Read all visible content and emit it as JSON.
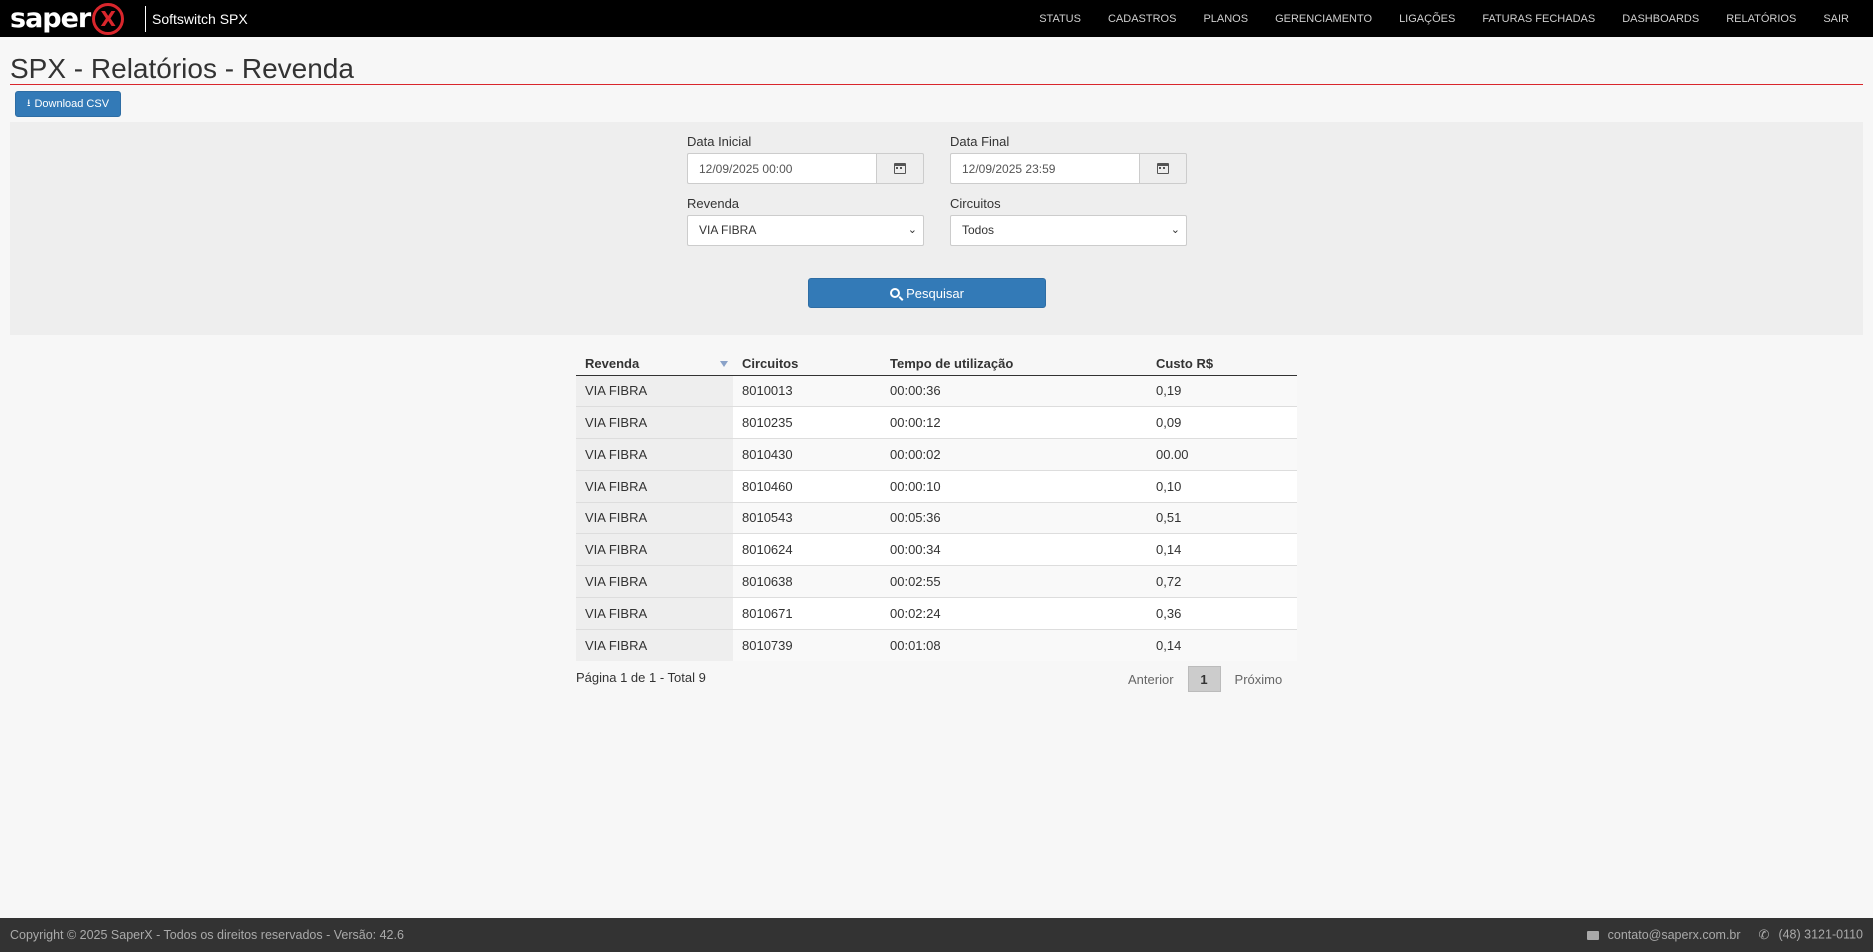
{
  "brand": {
    "logo_text": "saper",
    "logo_mark": "X",
    "product": "Softswitch SPX"
  },
  "nav": [
    "STATUS",
    "CADASTROS",
    "PLANOS",
    "GERENCIAMENTO",
    "LIGAÇÕES",
    "FATURAS FECHADAS",
    "DASHBOARDS",
    "RELATÓRIOS",
    "SAIR"
  ],
  "page": {
    "title": "SPX - Relatórios - Revenda",
    "download_label": "Download CSV"
  },
  "filters": {
    "data_inicial_label": "Data Inicial",
    "data_inicial_value": "12/09/2025 00:00",
    "data_final_label": "Data Final",
    "data_final_value": "12/09/2025 23:59",
    "revenda_label": "Revenda",
    "revenda_value": "VIA FIBRA",
    "circuitos_label": "Circuitos",
    "circuitos_value": "Todos",
    "search_label": "Pesquisar"
  },
  "table": {
    "headers": [
      "Revenda",
      "Circuitos",
      "Tempo de utilização",
      "Custo R$"
    ],
    "rows": [
      [
        "VIA FIBRA",
        "8010013",
        "00:00:36",
        "0,19"
      ],
      [
        "VIA FIBRA",
        "8010235",
        "00:00:12",
        "0,09"
      ],
      [
        "VIA FIBRA",
        "8010430",
        "00:00:02",
        "00.00"
      ],
      [
        "VIA FIBRA",
        "8010460",
        "00:00:10",
        "0,10"
      ],
      [
        "VIA FIBRA",
        "8010543",
        "00:05:36",
        "0,51"
      ],
      [
        "VIA FIBRA",
        "8010624",
        "00:00:34",
        "0,14"
      ],
      [
        "VIA FIBRA",
        "8010638",
        "00:02:55",
        "0,72"
      ],
      [
        "VIA FIBRA",
        "8010671",
        "00:02:24",
        "0,36"
      ],
      [
        "VIA FIBRA",
        "8010739",
        "00:01:08",
        "0,14"
      ]
    ]
  },
  "pagination": {
    "info": "Página 1 de 1 - Total 9",
    "prev": "Anterior",
    "current": "1",
    "next": "Próximo"
  },
  "footer": {
    "copyright": "Copyright © 2025 SaperX - Todos os direitos reservados - Versão: 42.6",
    "email": "contato@saperx.com.br",
    "phone": "(48) 3121-0110"
  }
}
